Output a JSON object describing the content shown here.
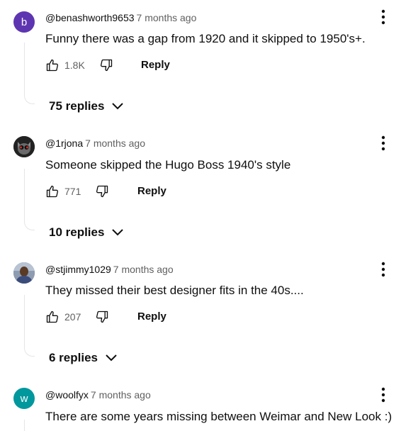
{
  "colors": {
    "avatar_b": "#5e35b1",
    "avatar_w": "#00979d",
    "meta_text": "#606060",
    "primary_text": "#0f0f0f"
  },
  "comments": [
    {
      "avatar_letter": "b",
      "author": "@benashworth9653",
      "time": "7 months ago",
      "text": "Funny there was a gap from 1920 and it skipped to 1950's+.",
      "likes": "1.8K",
      "reply_label": "Reply",
      "replies_label": "75 replies",
      "icons": [
        "thumb-up-icon",
        "thumb-down-icon",
        "more-vert-icon",
        "chevron-down-icon"
      ]
    },
    {
      "avatar_letter": "",
      "author": "@1rjona",
      "time": "7 months ago",
      "text": "Someone skipped the Hugo Boss 1940's style",
      "likes": "771",
      "reply_label": "Reply",
      "replies_label": "10 replies",
      "icons": [
        "thumb-up-icon",
        "thumb-down-icon",
        "more-vert-icon",
        "chevron-down-icon"
      ]
    },
    {
      "avatar_letter": "",
      "author": "@stjimmy1029",
      "time": "7 months ago",
      "text": "They missed their best designer fits in the 40s....",
      "likes": "207",
      "reply_label": "Reply",
      "replies_label": "6 replies",
      "icons": [
        "thumb-up-icon",
        "thumb-down-icon",
        "more-vert-icon",
        "chevron-down-icon"
      ]
    },
    {
      "avatar_letter": "w",
      "author": "@woolfyx",
      "time": "7 months ago",
      "text": "There are some years missing between Weimar and New Look :)",
      "icons": [
        "more-vert-icon"
      ]
    }
  ]
}
